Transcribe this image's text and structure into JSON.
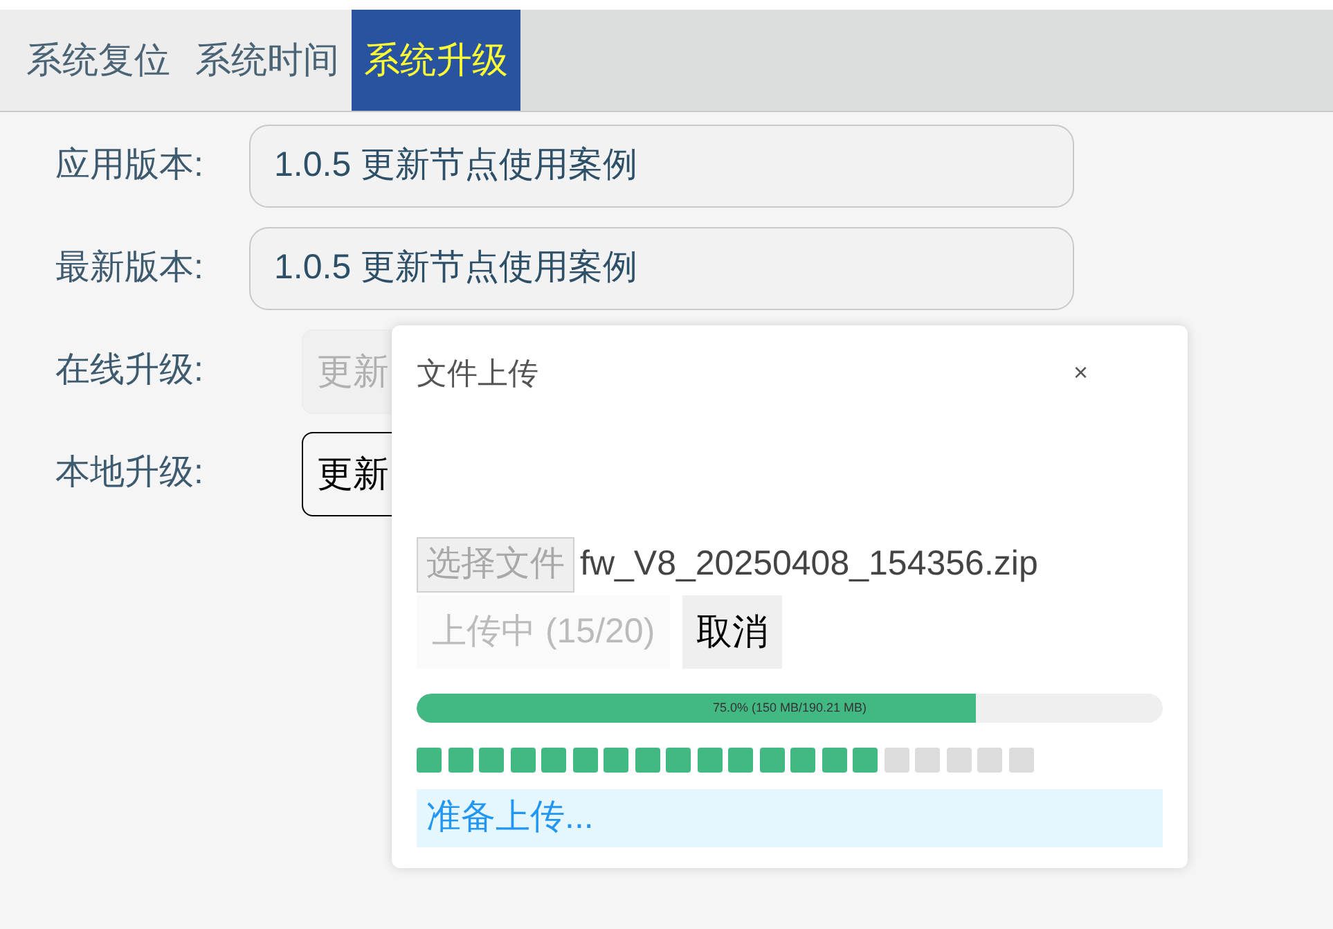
{
  "tabs": [
    {
      "label": "系统复位",
      "selected": false
    },
    {
      "label": "系统时间",
      "selected": false
    },
    {
      "label": "系统升级",
      "selected": true
    }
  ],
  "fields": [
    {
      "label": "应用版本:",
      "value": "1.0.5 更新节点使用案例"
    },
    {
      "label": "最新版本:",
      "value": "1.0.5 更新节点使用案例"
    }
  ],
  "upgrades": [
    {
      "label": "在线升级:",
      "button": "更新",
      "disabled": true
    },
    {
      "label": "本地升级:",
      "button": "更新",
      "disabled": false
    }
  ],
  "dialog": {
    "title": "文件上传",
    "close": "×",
    "choose_button": "选择文件",
    "file_name": "fw_V8_20250408_154356.zip",
    "upload_button": "上传中 (15/20)",
    "upload_disabled": true,
    "cancel_button": "取消",
    "progress": {
      "level": 0.75,
      "reading": "75.0% (150 MB/190.21 MB)"
    },
    "chunks": [
      {
        "done": true
      },
      {
        "done": true
      },
      {
        "done": true
      },
      {
        "done": true
      },
      {
        "done": true
      },
      {
        "done": true
      },
      {
        "done": true
      },
      {
        "done": true
      },
      {
        "done": true
      },
      {
        "done": true
      },
      {
        "done": true
      },
      {
        "done": true
      },
      {
        "done": true
      },
      {
        "done": true
      },
      {
        "done": true
      },
      {
        "done": false
      },
      {
        "done": false
      },
      {
        "done": false
      },
      {
        "done": false
      },
      {
        "done": false
      }
    ],
    "status": "准备上传..."
  }
}
